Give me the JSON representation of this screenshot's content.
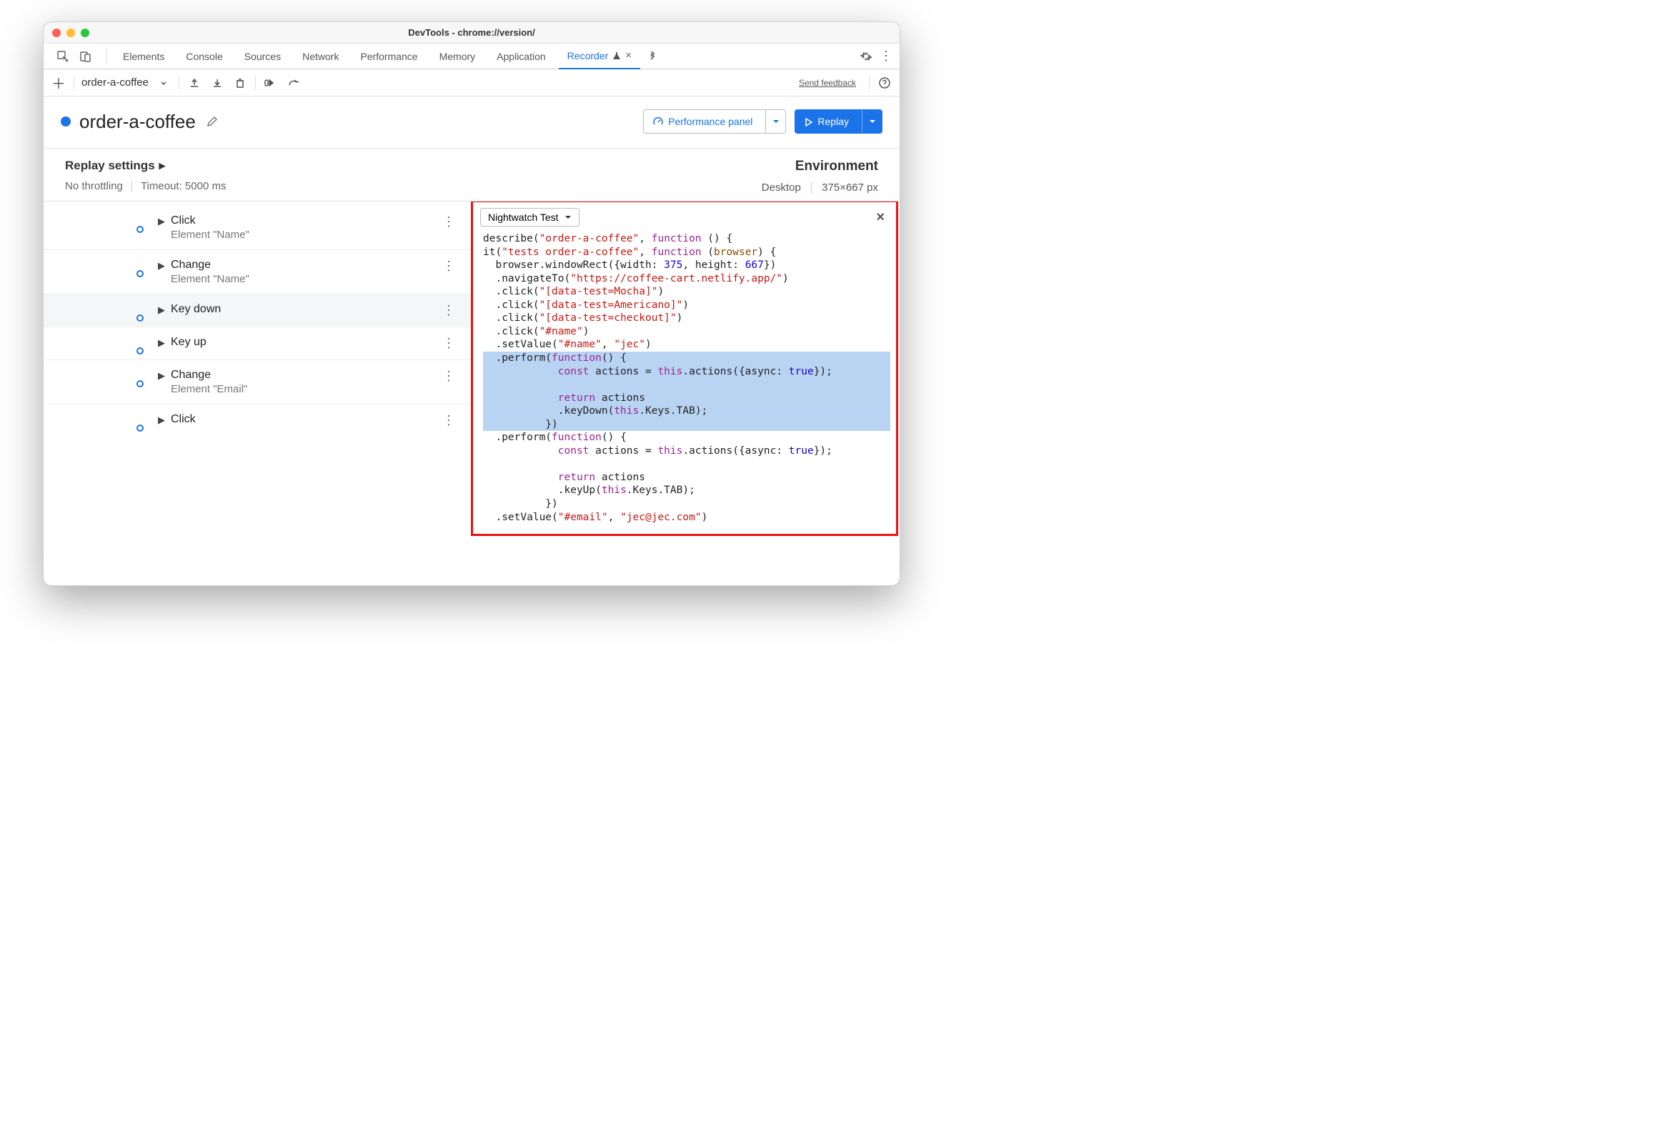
{
  "window_title": "DevTools - chrome://version/",
  "tabs": [
    "Elements",
    "Console",
    "Sources",
    "Network",
    "Performance",
    "Memory",
    "Application",
    "Recorder"
  ],
  "active_tab": "Recorder",
  "recorder_name": "order-a-coffee",
  "feedback_label": "Send feedback",
  "page_title": "order-a-coffee",
  "perf_button": "Performance panel",
  "replay_button": "Replay",
  "settings_heading": "Replay settings",
  "throttling": "No throttling",
  "timeout_label": "Timeout: 5000 ms",
  "env_heading": "Environment",
  "env_device": "Desktop",
  "env_viewport": "375×667 px",
  "steps": [
    {
      "title": "Click",
      "sub": "Element \"Name\""
    },
    {
      "title": "Change",
      "sub": "Element \"Name\""
    },
    {
      "title": "Key down",
      "sub": "",
      "highlight": true
    },
    {
      "title": "Key up",
      "sub": ""
    },
    {
      "title": "Change",
      "sub": "Element \"Email\""
    },
    {
      "title": "Click",
      "sub": ""
    }
  ],
  "export_dropdown": "Nightwatch Test",
  "code": {
    "l1_a": "describe(",
    "l1_b": "\"order-a-coffee\"",
    "l1_c": ", ",
    "l1_d": "function",
    "l1_e": " () {",
    "l2_a": "it(",
    "l2_b": "\"tests order-a-coffee\"",
    "l2_c": ", ",
    "l2_d": "function",
    "l2_e": " (",
    "l2_f": "browser",
    "l2_g": ") {",
    "l3_a": "  browser.windowRect({width: ",
    "l3_b": "375",
    "l3_c": ", height: ",
    "l3_d": "667",
    "l3_e": "})",
    "l4_a": "  .navigateTo(",
    "l4_b": "\"https://coffee-cart.netlify.app/\"",
    "l4_c": ")",
    "l5_a": "  .click(",
    "l5_b": "\"[data-test=Mocha]\"",
    "l5_c": ")",
    "l6_a": "  .click(",
    "l6_b": "\"[data-test=Americano]\"",
    "l6_c": ")",
    "l7_a": "  .click(",
    "l7_b": "\"[data-test=checkout]\"",
    "l7_c": ")",
    "l8_a": "  .click(",
    "l8_b": "\"#name\"",
    "l8_c": ")",
    "l9_a": "  .setValue(",
    "l9_b": "\"#name\"",
    "l9_c": ", ",
    "l9_d": "\"jec\"",
    "l9_e": ")",
    "l10_a": "  .perform(",
    "l10_b": "function",
    "l10_c": "() {",
    "l11_a": "            ",
    "l11_b": "const",
    "l11_c": " actions = ",
    "l11_d": "this",
    "l11_e": ".actions({async: ",
    "l11_f": "true",
    "l11_g": "});",
    "l12": "",
    "l13_a": "            ",
    "l13_b": "return",
    "l13_c": " actions",
    "l14_a": "            .keyDown(",
    "l14_b": "this",
    "l14_c": ".Keys.TAB);",
    "l15": "          })",
    "l16_a": "  .perform(",
    "l16_b": "function",
    "l16_c": "() {",
    "l17_a": "            ",
    "l17_b": "const",
    "l17_c": " actions = ",
    "l17_d": "this",
    "l17_e": ".actions({async: ",
    "l17_f": "true",
    "l17_g": "});",
    "l18": "",
    "l19_a": "            ",
    "l19_b": "return",
    "l19_c": " actions",
    "l20_a": "            .keyUp(",
    "l20_b": "this",
    "l20_c": ".Keys.TAB);",
    "l21": "          })",
    "l22_a": "  .setValue(",
    "l22_b": "\"#email\"",
    "l22_c": ", ",
    "l22_d": "\"jec@jec.com\"",
    "l22_e": ")"
  }
}
